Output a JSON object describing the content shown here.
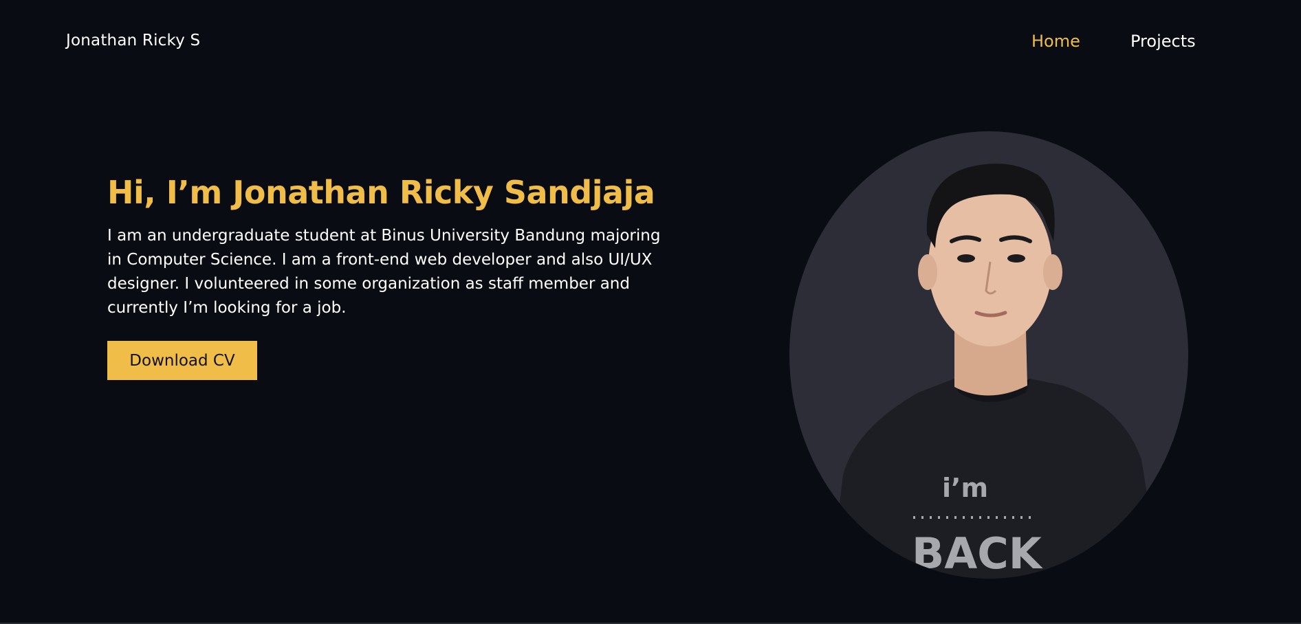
{
  "brand": {
    "name": "Jonathan Ricky S"
  },
  "nav": {
    "items": [
      {
        "label": "Home",
        "active": true
      },
      {
        "label": "Projects",
        "active": false
      }
    ]
  },
  "hero": {
    "heading": "Hi, I’m Jonathan Ricky Sandjaja",
    "description": "I am an undergraduate student at Binus University Bandung majoring in Computer Science. I am a front-end web developer and also UI/UX designer. I volunteered in some organization as staff member and currently I’m looking for a job.",
    "cta_label": "Download CV"
  },
  "portrait": {
    "shirt_text_top": "i’m",
    "shirt_text_bottom": "BACK"
  },
  "colors": {
    "background": "#0a0c14",
    "accent": "#f0be48",
    "text": "#ffffff",
    "portrait_bg": "#2c2d36"
  }
}
